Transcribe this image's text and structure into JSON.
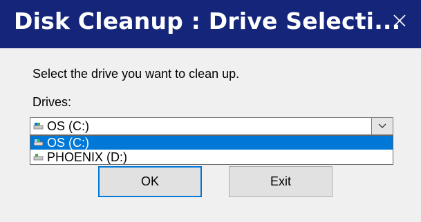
{
  "window": {
    "title": "Disk Cleanup : Drive Selecti...",
    "close_icon": "close-icon"
  },
  "dialog": {
    "prompt": "Select the drive you want to clean up.",
    "drives_label": "Drives:",
    "selected_drive": "OS (C:)",
    "options": [
      {
        "label": "OS (C:)",
        "icon": "system-drive-icon",
        "highlighted": true
      },
      {
        "label": "PHOENIX (D:)",
        "icon": "data-drive-icon",
        "highlighted": false
      }
    ]
  },
  "buttons": {
    "ok_label": "OK",
    "exit_label": "Exit"
  },
  "colors": {
    "title_bar": "#14257a",
    "selection": "#0078d7",
    "background": "#f0f0f0"
  }
}
